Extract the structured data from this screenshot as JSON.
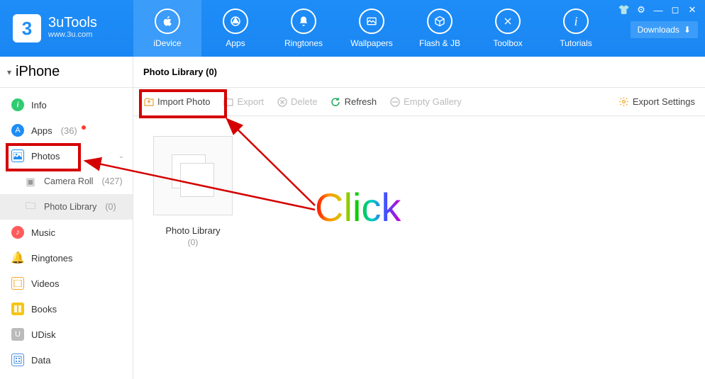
{
  "brand": {
    "name": "3uTools",
    "site": "www.3u.com",
    "badge": "3"
  },
  "nav": [
    {
      "label": "iDevice",
      "active": true
    },
    {
      "label": "Apps"
    },
    {
      "label": "Ringtones"
    },
    {
      "label": "Wallpapers"
    },
    {
      "label": "Flash & JB"
    },
    {
      "label": "Toolbox"
    },
    {
      "label": "Tutorials"
    }
  ],
  "downloads_label": "Downloads",
  "device_name": "iPhone",
  "sidebar": {
    "info": "Info",
    "apps": "Apps",
    "apps_count": "(36)",
    "photos": "Photos",
    "camera_roll": "Camera Roll",
    "camera_roll_count": "(427)",
    "photo_library": "Photo Library",
    "photo_library_count": "(0)",
    "music": "Music",
    "ringtones": "Ringtones",
    "videos": "Videos",
    "books": "Books",
    "udisk": "UDisk",
    "data": "Data"
  },
  "tab_title": "Photo Library (0)",
  "toolbar": {
    "import": "Import Photo",
    "export": "Export",
    "delete": "Delete",
    "refresh": "Refresh",
    "empty": "Empty Gallery",
    "settings": "Export Settings"
  },
  "tile": {
    "label": "Photo Library",
    "count": "(0)"
  },
  "annotation": "Click"
}
